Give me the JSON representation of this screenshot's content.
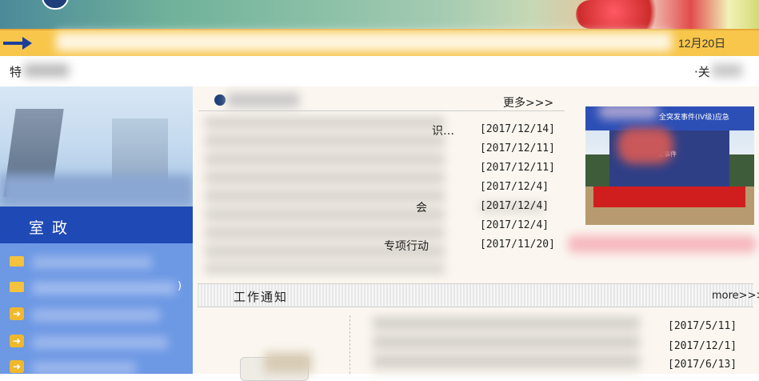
{
  "header": {
    "date_text": "12月20日"
  },
  "subbar": {
    "left_text": "特",
    "right_text": "·关"
  },
  "sidebar": {
    "section_title": "室 政",
    "items": [
      {
        "text": "",
        "icon": "folder-icon"
      },
      {
        "text": ")",
        "icon": "folder-icon"
      },
      {
        "text": "",
        "icon": "arrow-right-icon"
      },
      {
        "text": "",
        "icon": "arrow-right-icon"
      },
      {
        "text": "",
        "icon": "arrow-right-icon"
      }
    ]
  },
  "news": {
    "more_label": "更多>>>",
    "items": [
      {
        "title": "识…",
        "date": "[2017/12/14]"
      },
      {
        "title": "",
        "date": "[2017/12/11]"
      },
      {
        "title": "",
        "date": "[2017/12/11]"
      },
      {
        "title": "",
        "date": "[2017/12/4]"
      },
      {
        "title": "会",
        "date": "[2017/12/4]"
      },
      {
        "title": "",
        "date": "[2017/12/4]"
      },
      {
        "title": "专项行动",
        "date": "[2017/11/20]"
      }
    ]
  },
  "featured": {
    "banner_text": "全突发事件(IV级)应急",
    "board_text": "发事件"
  },
  "notices": {
    "title": "工作通知",
    "more_label": "more>>>",
    "items": [
      {
        "title": "",
        "date": "[2017/5/11]"
      },
      {
        "title": "",
        "date": "[2017/12/1]"
      },
      {
        "title": "",
        "date": "[2017/6/13]"
      }
    ]
  },
  "colors": {
    "accent_yellow": "#f7c64a",
    "nav_blue": "#1a3f9c",
    "sidebar_blue": "#6a93df",
    "stage_red": "#d01e1e"
  }
}
